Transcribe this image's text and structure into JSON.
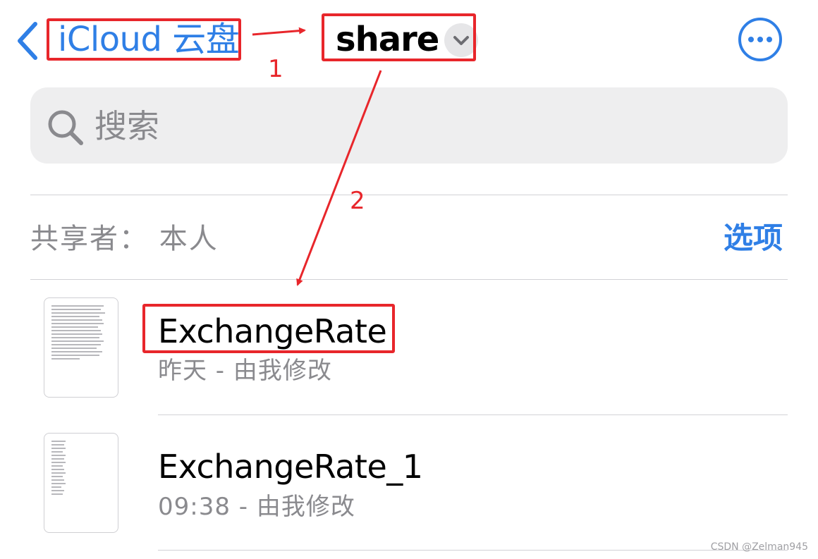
{
  "header": {
    "back_label": "iCloud 云盘",
    "title": "share",
    "more_icon": "ellipsis-circle-icon",
    "title_chevron_icon": "chevron-down-icon",
    "accent": "#2f7fe6"
  },
  "search": {
    "placeholder": "搜索",
    "icon": "search-icon"
  },
  "section": {
    "shared_by": "共享者：  本人",
    "options_label": "选项"
  },
  "files": [
    {
      "name": "ExchangeRate",
      "meta": "昨天 - 由我修改"
    },
    {
      "name": "ExchangeRate_1",
      "meta": "09:38 - 由我修改"
    }
  ],
  "annotations": {
    "color": "#e8262b",
    "step1": "1",
    "step2": "2"
  },
  "watermark": "CSDN @Zelman945"
}
